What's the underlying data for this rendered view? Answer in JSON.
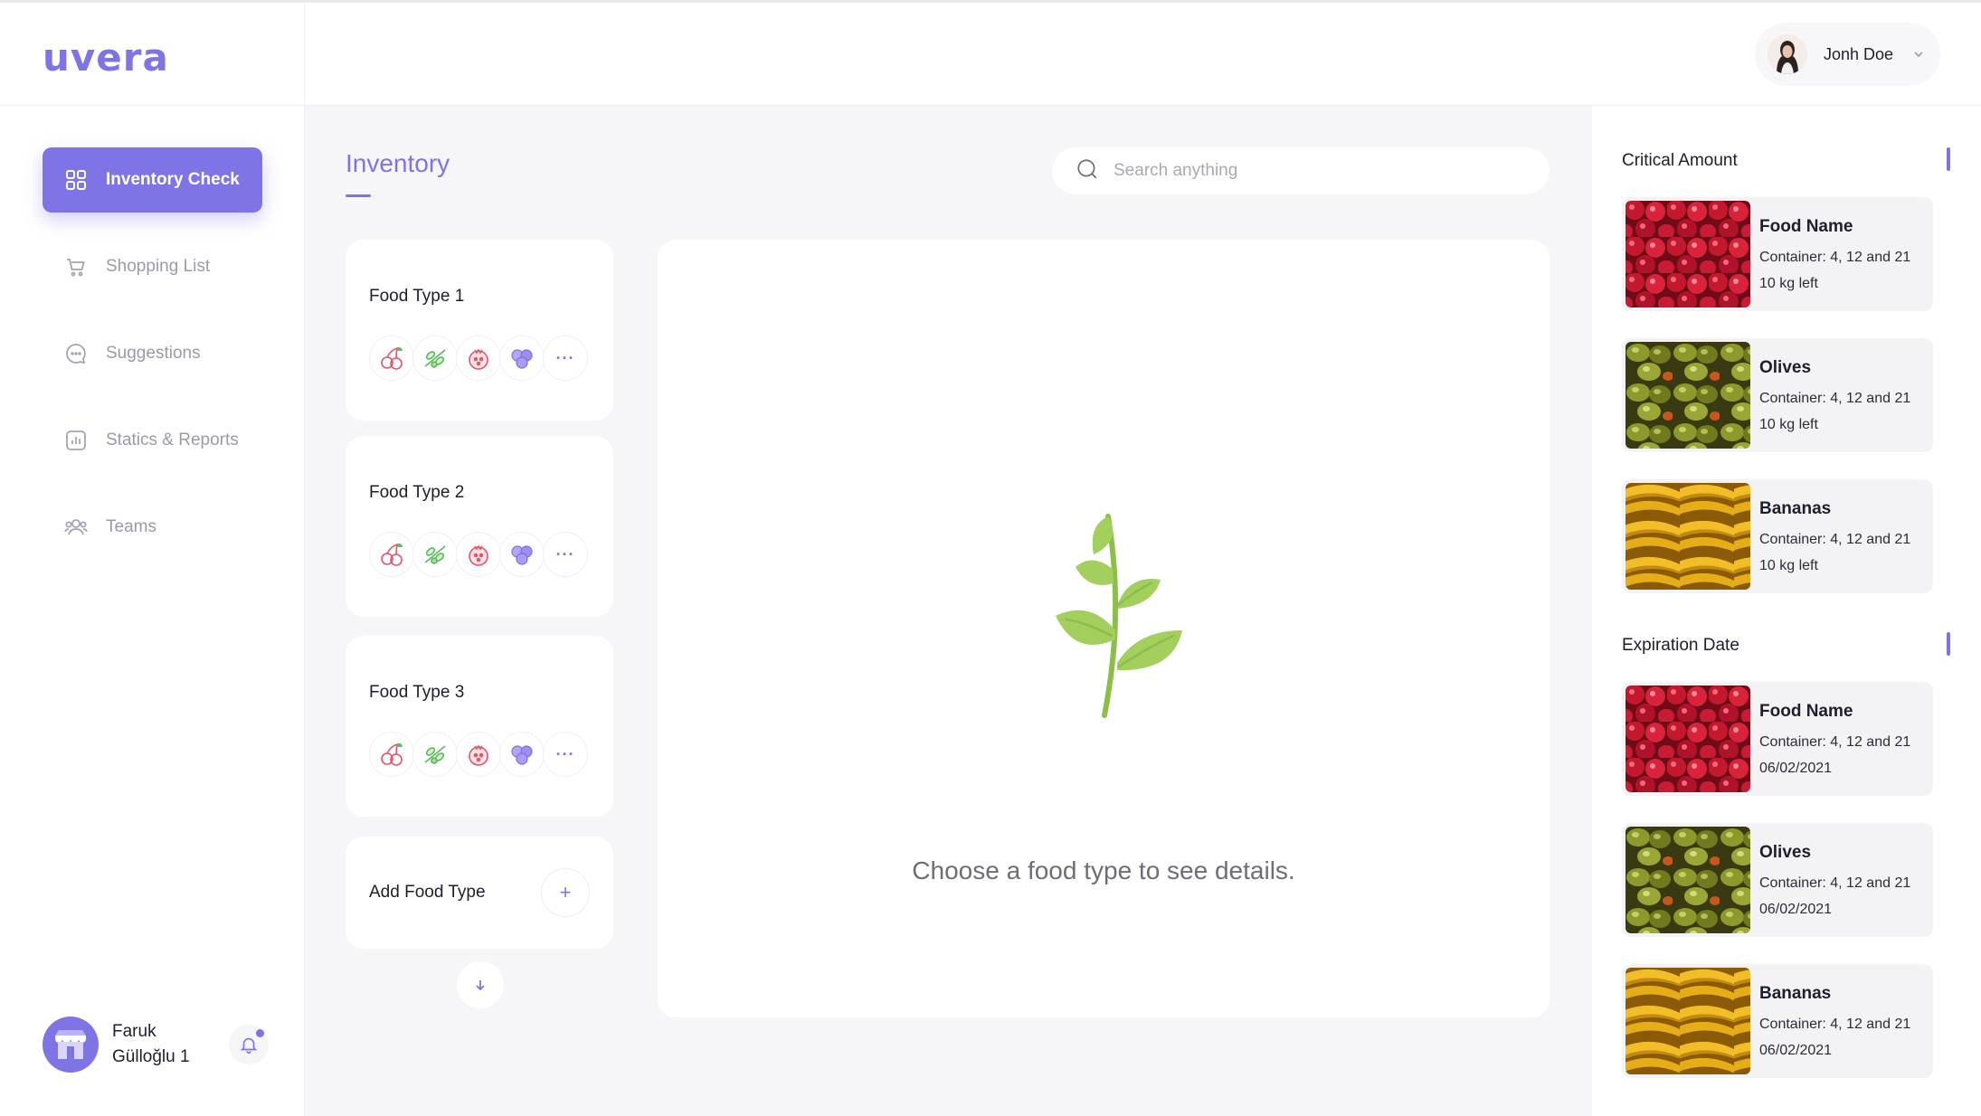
{
  "app": {
    "logo": "uvera"
  },
  "sidebar": {
    "items": [
      {
        "label": "Inventory Check",
        "icon": "grid-icon",
        "active": true
      },
      {
        "label": "Shopping List",
        "icon": "cart-icon",
        "active": false
      },
      {
        "label": "Suggestions",
        "icon": "chat-icon",
        "active": false
      },
      {
        "label": "Statics & Reports",
        "icon": "chart-icon",
        "active": false
      },
      {
        "label": "Teams",
        "icon": "team-icon",
        "active": false
      }
    ],
    "user": {
      "name": "Faruk Gülloğlu 1"
    }
  },
  "header": {
    "profile_name": "Jonh Doe"
  },
  "main": {
    "title": "Inventory",
    "search_placeholder": "Search anything",
    "food_types": [
      {
        "title": "Food Type 1",
        "icons": [
          "cherry-icon",
          "olive-icon",
          "pomegranate-icon",
          "blueberry-icon"
        ],
        "more": "···"
      },
      {
        "title": "Food Type 2",
        "icons": [
          "cherry-icon",
          "olive-icon",
          "pomegranate-icon",
          "blueberry-icon"
        ],
        "more": "···"
      },
      {
        "title": "Food Type 3",
        "icons": [
          "cherry-icon",
          "olive-icon",
          "pomegranate-icon",
          "blueberry-icon"
        ],
        "more": "···"
      }
    ],
    "add_label": "Add Food Type",
    "add_symbol": "+",
    "empty_message": "Choose a food type to see details."
  },
  "right": {
    "critical_title": "Critical Amount",
    "critical_items": [
      {
        "name": "Food Name",
        "container": "Container: 4, 12 and 21",
        "detail": "10 kg left",
        "image": "cherries"
      },
      {
        "name": "Olives",
        "container": "Container: 4, 12 and 21",
        "detail": "10 kg left",
        "image": "olives"
      },
      {
        "name": "Bananas",
        "container": "Container: 4, 12 and 21",
        "detail": "10 kg left",
        "image": "bananas"
      }
    ],
    "expiration_title": "Expiration Date",
    "expiration_items": [
      {
        "name": "Food Name",
        "container": "Container: 4, 12 and 21",
        "detail": "06/02/2021",
        "image": "cherries"
      },
      {
        "name": "Olives",
        "container": "Container: 4, 12 and 21",
        "detail": "06/02/2021",
        "image": "olives"
      },
      {
        "name": "Bananas",
        "container": "Container: 4, 12 and 21",
        "detail": "06/02/2021",
        "image": "bananas"
      }
    ]
  },
  "colors": {
    "accent": "#7e74e6",
    "background": "#f6f6f8",
    "sprout": "#9fcc59"
  }
}
